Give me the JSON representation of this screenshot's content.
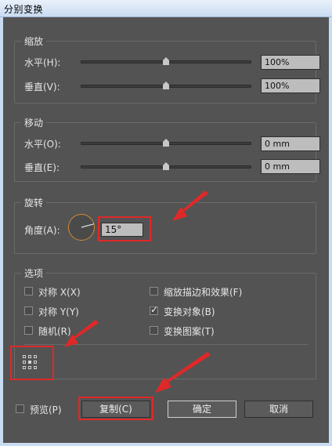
{
  "window": {
    "title": "分别变换"
  },
  "scale": {
    "legend": "缩放",
    "horizontal": {
      "label": "水平(H):",
      "value": "100%",
      "slider_fraction": 0.5
    },
    "vertical": {
      "label": "垂直(V):",
      "value": "100%",
      "slider_fraction": 0.5
    }
  },
  "move": {
    "legend": "移动",
    "horizontal": {
      "label": "水平(O):",
      "value": "0 mm",
      "slider_fraction": 0.5
    },
    "vertical": {
      "label": "垂直(E):",
      "value": "0 mm",
      "slider_fraction": 0.5
    }
  },
  "rotate": {
    "legend": "旋转",
    "angle_label": "角度(A):",
    "angle_value": "15°"
  },
  "options": {
    "legend": "选项",
    "left": [
      {
        "label": "对称 X(X)",
        "checked": false
      },
      {
        "label": "对称 Y(Y)",
        "checked": false
      },
      {
        "label": "随机(R)",
        "checked": false
      }
    ],
    "right": [
      {
        "label": "缩放描边和效果(F)",
        "checked": false
      },
      {
        "label": "变换对象(B)",
        "checked": true
      },
      {
        "label": "变换图案(T)",
        "checked": false
      }
    ]
  },
  "footer": {
    "preview_label": "预览(P)",
    "preview_checked": false,
    "copy_label": "复制(C)",
    "ok_label": "确定",
    "cancel_label": "取消"
  },
  "colors": {
    "dialog_bg": "#535353",
    "highlight": "#e02828",
    "dial_accent": "#d48a30"
  }
}
